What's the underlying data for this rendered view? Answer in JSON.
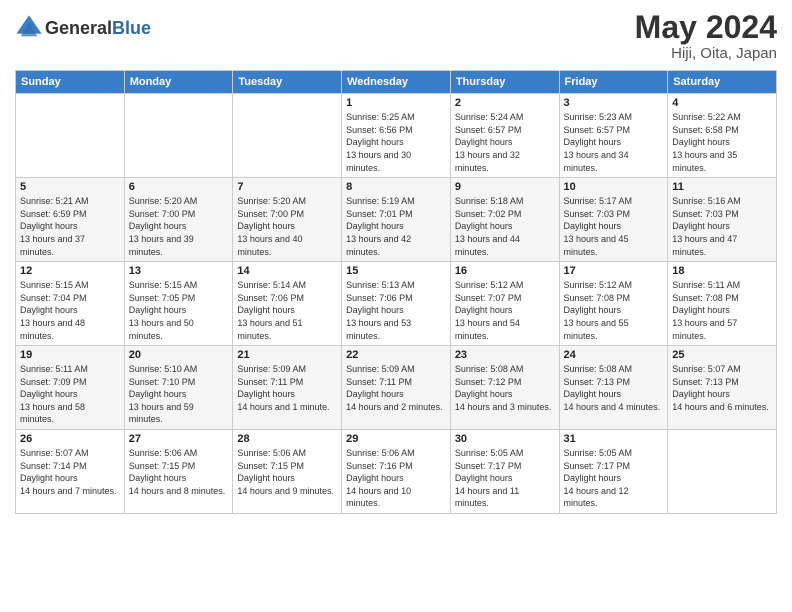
{
  "header": {
    "logo": {
      "text_general": "General",
      "text_blue": "Blue"
    },
    "title": "May 2024",
    "location": "Hiji, Oita, Japan"
  },
  "weekdays": [
    "Sunday",
    "Monday",
    "Tuesday",
    "Wednesday",
    "Thursday",
    "Friday",
    "Saturday"
  ],
  "weeks": [
    [
      null,
      null,
      null,
      {
        "day": 1,
        "sunrise": "5:25 AM",
        "sunset": "6:56 PM",
        "daylight": "13 hours and 30 minutes."
      },
      {
        "day": 2,
        "sunrise": "5:24 AM",
        "sunset": "6:57 PM",
        "daylight": "13 hours and 32 minutes."
      },
      {
        "day": 3,
        "sunrise": "5:23 AM",
        "sunset": "6:57 PM",
        "daylight": "13 hours and 34 minutes."
      },
      {
        "day": 4,
        "sunrise": "5:22 AM",
        "sunset": "6:58 PM",
        "daylight": "13 hours and 35 minutes."
      }
    ],
    [
      {
        "day": 5,
        "sunrise": "5:21 AM",
        "sunset": "6:59 PM",
        "daylight": "13 hours and 37 minutes."
      },
      {
        "day": 6,
        "sunrise": "5:20 AM",
        "sunset": "7:00 PM",
        "daylight": "13 hours and 39 minutes."
      },
      {
        "day": 7,
        "sunrise": "5:20 AM",
        "sunset": "7:00 PM",
        "daylight": "13 hours and 40 minutes."
      },
      {
        "day": 8,
        "sunrise": "5:19 AM",
        "sunset": "7:01 PM",
        "daylight": "13 hours and 42 minutes."
      },
      {
        "day": 9,
        "sunrise": "5:18 AM",
        "sunset": "7:02 PM",
        "daylight": "13 hours and 44 minutes."
      },
      {
        "day": 10,
        "sunrise": "5:17 AM",
        "sunset": "7:03 PM",
        "daylight": "13 hours and 45 minutes."
      },
      {
        "day": 11,
        "sunrise": "5:16 AM",
        "sunset": "7:03 PM",
        "daylight": "13 hours and 47 minutes."
      }
    ],
    [
      {
        "day": 12,
        "sunrise": "5:15 AM",
        "sunset": "7:04 PM",
        "daylight": "13 hours and 48 minutes."
      },
      {
        "day": 13,
        "sunrise": "5:15 AM",
        "sunset": "7:05 PM",
        "daylight": "13 hours and 50 minutes."
      },
      {
        "day": 14,
        "sunrise": "5:14 AM",
        "sunset": "7:06 PM",
        "daylight": "13 hours and 51 minutes."
      },
      {
        "day": 15,
        "sunrise": "5:13 AM",
        "sunset": "7:06 PM",
        "daylight": "13 hours and 53 minutes."
      },
      {
        "day": 16,
        "sunrise": "5:12 AM",
        "sunset": "7:07 PM",
        "daylight": "13 hours and 54 minutes."
      },
      {
        "day": 17,
        "sunrise": "5:12 AM",
        "sunset": "7:08 PM",
        "daylight": "13 hours and 55 minutes."
      },
      {
        "day": 18,
        "sunrise": "5:11 AM",
        "sunset": "7:08 PM",
        "daylight": "13 hours and 57 minutes."
      }
    ],
    [
      {
        "day": 19,
        "sunrise": "5:11 AM",
        "sunset": "7:09 PM",
        "daylight": "13 hours and 58 minutes."
      },
      {
        "day": 20,
        "sunrise": "5:10 AM",
        "sunset": "7:10 PM",
        "daylight": "13 hours and 59 minutes."
      },
      {
        "day": 21,
        "sunrise": "5:09 AM",
        "sunset": "7:11 PM",
        "daylight": "14 hours and 1 minute."
      },
      {
        "day": 22,
        "sunrise": "5:09 AM",
        "sunset": "7:11 PM",
        "daylight": "14 hours and 2 minutes."
      },
      {
        "day": 23,
        "sunrise": "5:08 AM",
        "sunset": "7:12 PM",
        "daylight": "14 hours and 3 minutes."
      },
      {
        "day": 24,
        "sunrise": "5:08 AM",
        "sunset": "7:13 PM",
        "daylight": "14 hours and 4 minutes."
      },
      {
        "day": 25,
        "sunrise": "5:07 AM",
        "sunset": "7:13 PM",
        "daylight": "14 hours and 6 minutes."
      }
    ],
    [
      {
        "day": 26,
        "sunrise": "5:07 AM",
        "sunset": "7:14 PM",
        "daylight": "14 hours and 7 minutes."
      },
      {
        "day": 27,
        "sunrise": "5:06 AM",
        "sunset": "7:15 PM",
        "daylight": "14 hours and 8 minutes."
      },
      {
        "day": 28,
        "sunrise": "5:06 AM",
        "sunset": "7:15 PM",
        "daylight": "14 hours and 9 minutes."
      },
      {
        "day": 29,
        "sunrise": "5:06 AM",
        "sunset": "7:16 PM",
        "daylight": "14 hours and 10 minutes."
      },
      {
        "day": 30,
        "sunrise": "5:05 AM",
        "sunset": "7:17 PM",
        "daylight": "14 hours and 11 minutes."
      },
      {
        "day": 31,
        "sunrise": "5:05 AM",
        "sunset": "7:17 PM",
        "daylight": "14 hours and 12 minutes."
      },
      null
    ]
  ]
}
